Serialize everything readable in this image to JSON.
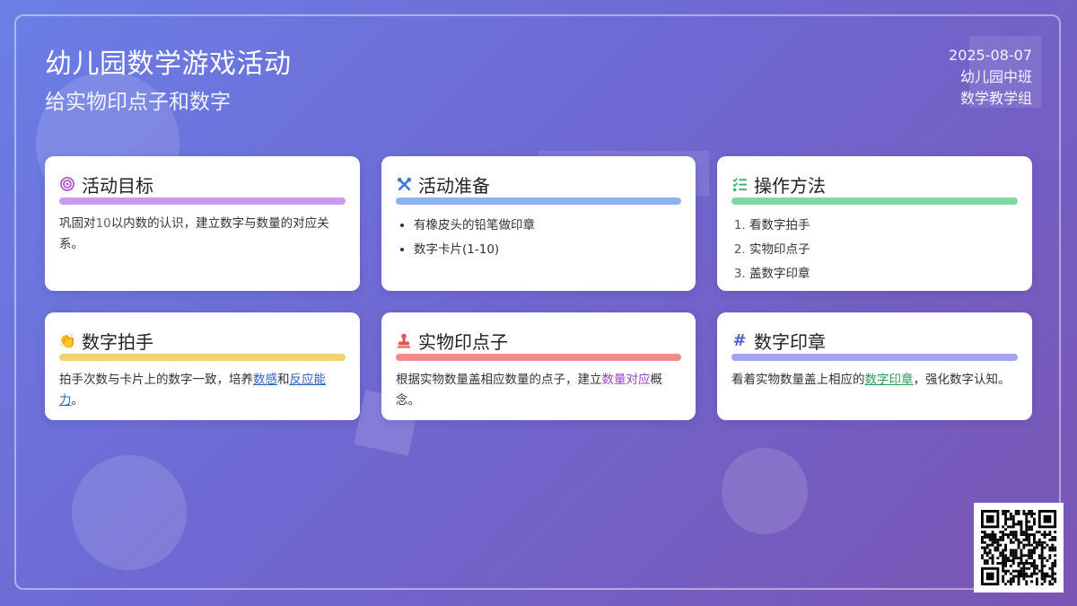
{
  "header": {
    "title": "幼儿园数学游戏活动",
    "subtitle": "给实物印点子和数字"
  },
  "meta": {
    "date": "2025-08-07",
    "class_name": "幼儿园中班",
    "group": "数学教学组"
  },
  "colors": {
    "purple": "#c99af2",
    "blue": "#8eb4f0",
    "green": "#7fd89d",
    "yellow": "#f0d273",
    "red": "#f28b8b",
    "indigo": "#a3a6ee"
  },
  "cards": [
    {
      "title": "活动目标",
      "icon": "target-icon",
      "body_parts": [
        "巩固对",
        "10",
        "以内数的认识，建立数字与数量的对应关系。"
      ]
    },
    {
      "title": "活动准备",
      "icon": "tools-icon",
      "items": [
        "有橡皮头的铅笔做印章",
        "数字卡片(1-10)"
      ]
    },
    {
      "title": "操作方法",
      "icon": "checklist-icon",
      "steps": [
        "看数字拍手",
        "实物印点子",
        "盖数字印章"
      ]
    },
    {
      "title": "数字拍手",
      "icon": "clapping-hands-icon",
      "body_parts": [
        "拍手次数与卡片上的数字一致，培养",
        "数感",
        "和",
        "反应能力",
        "。"
      ]
    },
    {
      "title": "实物印点子",
      "icon": "stamp-icon",
      "body_parts": [
        "根据实物数量盖相应数量的点子，建立",
        "数量对应",
        "概念。"
      ]
    },
    {
      "title": "数字印章",
      "icon": "hashtag-icon",
      "body_parts": [
        "看着实物数量盖上相应的",
        "数字印章",
        "，强化数字认知。"
      ]
    }
  ]
}
